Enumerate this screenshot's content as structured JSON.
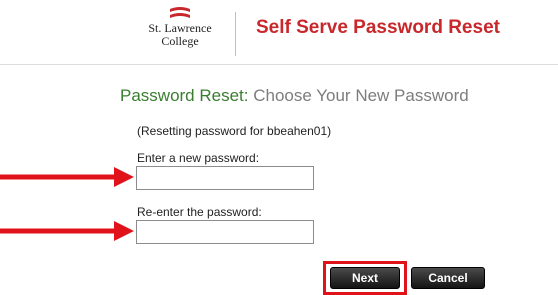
{
  "header": {
    "logo": {
      "line1": "St. Lawrence",
      "line2": "College"
    },
    "title": "Self Serve Password Reset"
  },
  "page": {
    "heading_prefix": "Password Reset:",
    "heading_rest": "Choose Your New Password",
    "resetting_note": "(Resetting password for bbeahen01)"
  },
  "form": {
    "new_password_label": "Enter a new password:",
    "new_password_value": "",
    "confirm_password_label": "Re-enter the password:",
    "confirm_password_value": "",
    "next_label": "Next",
    "cancel_label": "Cancel"
  },
  "colors": {
    "brand_red": "#c8282c",
    "heading_green": "#3a7d30",
    "annotation_red": "#e0131a"
  }
}
